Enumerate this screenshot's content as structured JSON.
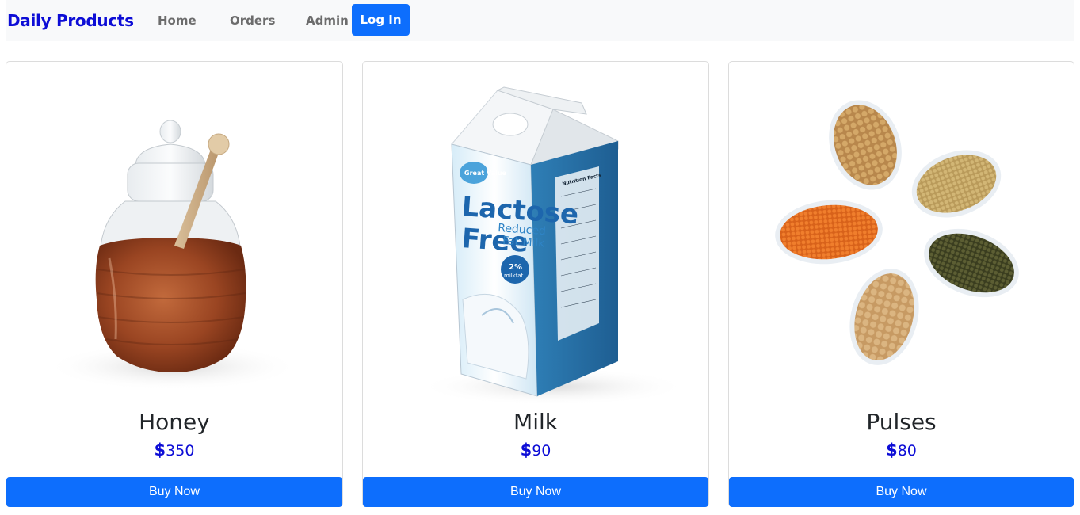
{
  "navbar": {
    "brand": "Daily Products",
    "links": [
      "Home",
      "Orders",
      "Admin"
    ],
    "login_label": "Log In"
  },
  "products": [
    {
      "name": "Honey",
      "currency": "$",
      "price": "350",
      "buy_label": "Buy Now",
      "image": "honey-jar-image"
    },
    {
      "name": "Milk",
      "currency": "$",
      "price": "90",
      "buy_label": "Buy Now",
      "image": "milk-carton-image"
    },
    {
      "name": "Pulses",
      "currency": "$",
      "price": "80",
      "buy_label": "Buy Now",
      "image": "pulses-bowls-image"
    }
  ],
  "milk_carton_text": {
    "brand": "Great Value",
    "line1": "Lactose",
    "line2": "Free",
    "line3": "Reduced",
    "line4": "Fat Milk",
    "badge_pct": "2%",
    "badge_word": "milkfat",
    "side_title": "Nutrition Facts"
  },
  "colors": {
    "accent": "#0d6efd",
    "brand": "#0d0dd6",
    "navbar_bg": "#f8f9fa"
  }
}
